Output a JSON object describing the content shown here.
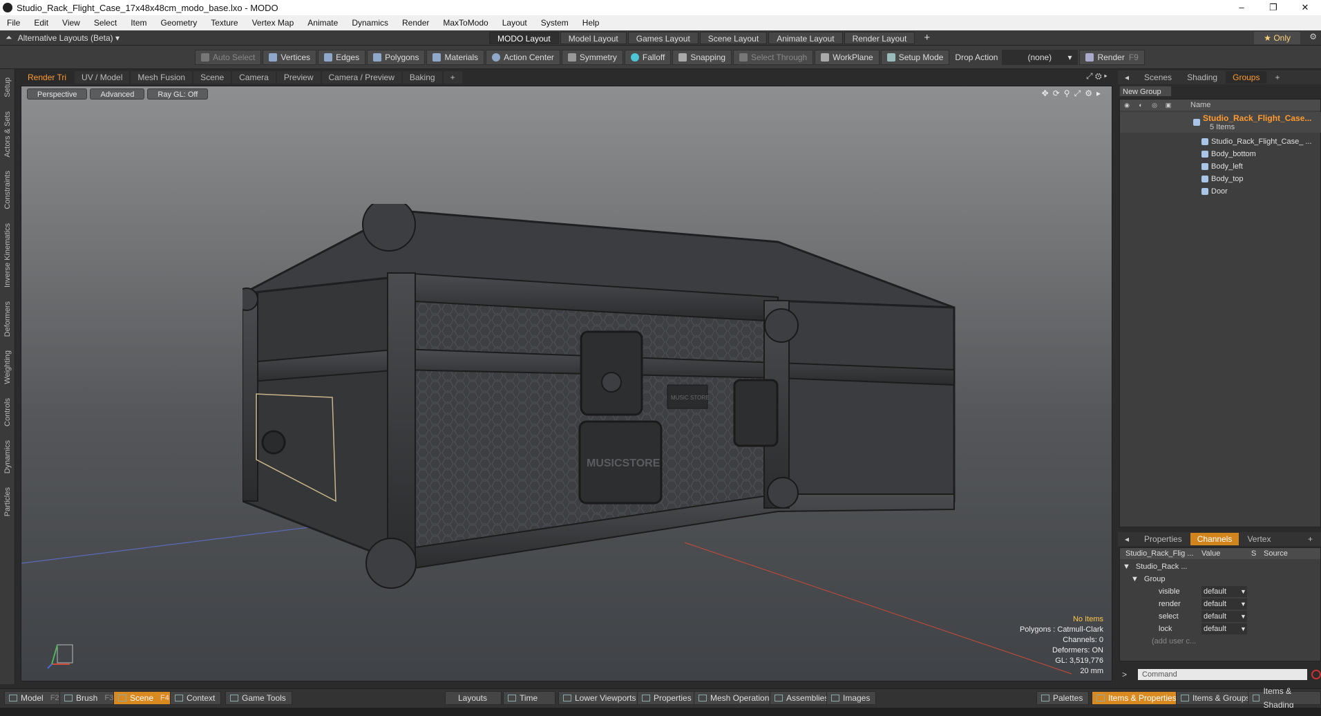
{
  "window": {
    "title": "Studio_Rack_Flight_Case_17x48x48cm_modo_base.lxo - MODO"
  },
  "menu": [
    "File",
    "Edit",
    "View",
    "Select",
    "Item",
    "Geometry",
    "Texture",
    "Vertex Map",
    "Animate",
    "Dynamics",
    "Render",
    "MaxToModo",
    "Layout",
    "System",
    "Help"
  ],
  "layoutbar": {
    "alt": "Alternative Layouts (Beta) ▾",
    "tabs": [
      "MODO Layout",
      "Model Layout",
      "Games Layout",
      "Scene Layout",
      "Animate Layout",
      "Render Layout"
    ],
    "add": "+",
    "only": "★  Only"
  },
  "toolbar": {
    "auto_select": "Auto Select",
    "vertices": "Vertices",
    "edges": "Edges",
    "polygons": "Polygons",
    "materials": "Materials",
    "action_center": "Action Center",
    "symmetry": "Symmetry",
    "falloff": "Falloff",
    "snapping": "Snapping",
    "select_through": "Select Through",
    "workplane": "WorkPlane",
    "setup_mode": "Setup Mode",
    "drop_action": "Drop Action",
    "drop_value": "(none)",
    "render": "Render",
    "render_key": "F9"
  },
  "left_tabs": [
    "Setup",
    "Actors & Sets",
    "Constraints",
    "Inverse Kinematics",
    "Deformers",
    "Weighting",
    "Controls",
    "Dynamics",
    "Particles"
  ],
  "viewport": {
    "tabs": [
      "Render Tri",
      "UV / Model",
      "Mesh Fusion",
      "Scene",
      "Camera",
      "Preview",
      "Camera / Preview",
      "Baking"
    ],
    "add": "+",
    "header": [
      "Perspective",
      "Advanced",
      "Ray GL: Off"
    ],
    "label_front": "MUSIC STORE",
    "label_plate": "MUSICSTORE",
    "stats": {
      "items": "No Items",
      "polygons": "Polygons : Catmull-Clark",
      "channels": "Channels: 0",
      "deformers": "Deformers: ON",
      "gl": "GL: 3,519,776",
      "unit": "20 mm"
    }
  },
  "right": {
    "tabs": [
      "Scenes",
      "Shading",
      "Groups"
    ],
    "add": "+",
    "new_group": "New Group",
    "col_name": "Name",
    "group": {
      "name": "Studio_Rack_Flight_Case...",
      "count": "5 Items"
    },
    "items": [
      "Studio_Rack_Flight_Case_ ...",
      "Body_bottom",
      "Body_left",
      "Body_top",
      "Door"
    ]
  },
  "props": {
    "tabs": [
      "Properties",
      "Channels",
      "Vertex Maps"
    ],
    "add": "+",
    "cols": [
      "Studio_Rack_Flig ...",
      "Value",
      "S",
      "Source"
    ],
    "tree1": "Studio_Rack ...",
    "tree2": "Group",
    "rows": [
      {
        "label": "visible",
        "value": "default"
      },
      {
        "label": "render",
        "value": "default"
      },
      {
        "label": "select",
        "value": "default"
      },
      {
        "label": "lock",
        "value": "default"
      }
    ],
    "add_user": "(add user c...",
    "command_placeholder": "Command"
  },
  "bottom": {
    "model": "Model",
    "model_k": "F2",
    "brush": "Brush",
    "brush_k": "F3",
    "scene": "Scene",
    "scene_k": "F4",
    "context": "Context",
    "game_tools": "Game Tools",
    "layouts": "Layouts",
    "time": "Time",
    "lower": "Lower Viewports",
    "properties": "Properties",
    "mesh_ops": "Mesh Operations",
    "assemblies": "Assemblies",
    "images": "Images",
    "palettes": "Palettes",
    "items_props": "Items & Properties",
    "items_groups": "Items & Groups",
    "items_shading": "Items & Shading"
  }
}
